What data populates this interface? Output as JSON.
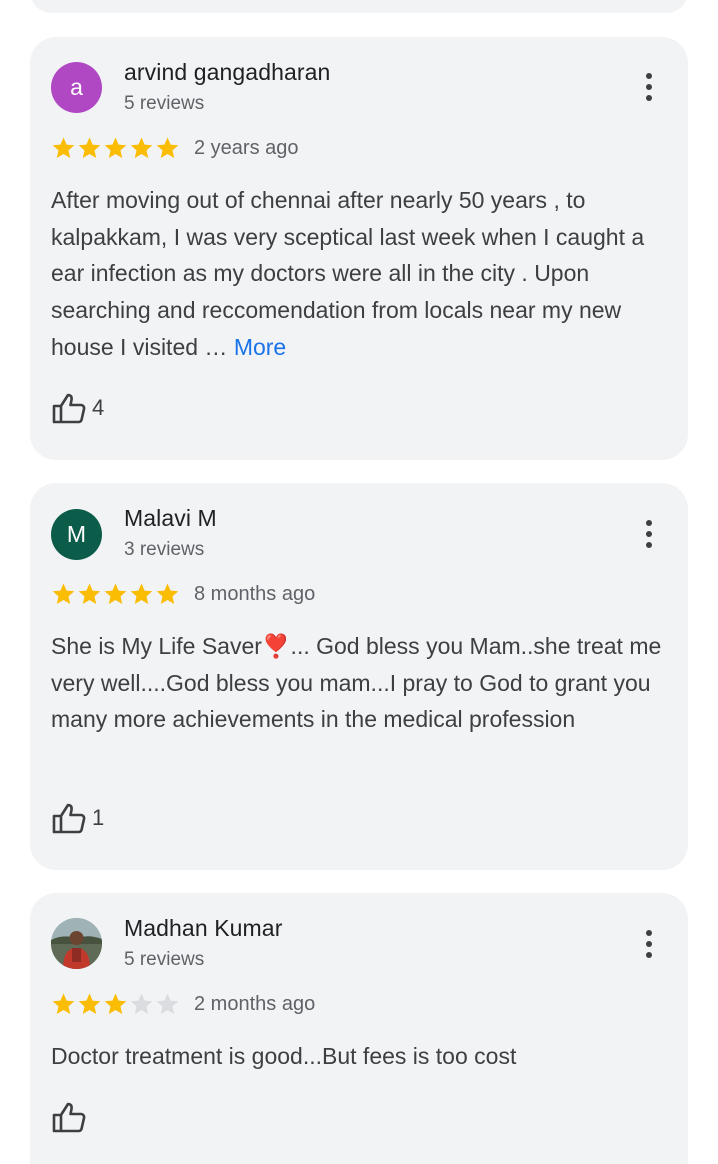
{
  "reviews": [
    {
      "avatar_letter": "a",
      "avatar_color": "#b048c4",
      "name": "arvind gangadharan",
      "review_count": "5 reviews",
      "rating": 5,
      "date": "2 years ago",
      "text": "After moving out of chennai after nearly 50 years , to kalpakkam, I was very sceptical last week when I caught a ear infection as my doctors were all in the city . Upon searching and reccomendation from locals near my new house I visited … ",
      "more_label": "More",
      "likes": "4"
    },
    {
      "avatar_letter": "M",
      "avatar_color": "#0b5d4a",
      "name": "Malavi M",
      "review_count": "3 reviews",
      "rating": 5,
      "date": "8 months ago",
      "text": "She is My Life Saver❣️... God bless you Mam..she treat me very well....God bless you mam...I pray to God to grant you many more achievements in the medical profession",
      "likes": "1"
    },
    {
      "avatar_type": "photo",
      "name": "Madhan Kumar",
      "review_count": "5 reviews",
      "rating": 3,
      "date": "2 months ago",
      "text": "Doctor treatment is good...But fees is too cost",
      "likes": ""
    }
  ],
  "colors": {
    "card_bg": "#f2f3f5",
    "star_filled": "#fbbc04",
    "star_empty": "#dadce0",
    "link": "#1a73e8"
  },
  "icons": {
    "menu": "more-vert-icon",
    "like": "thumb-up-icon",
    "star": "star-icon"
  }
}
